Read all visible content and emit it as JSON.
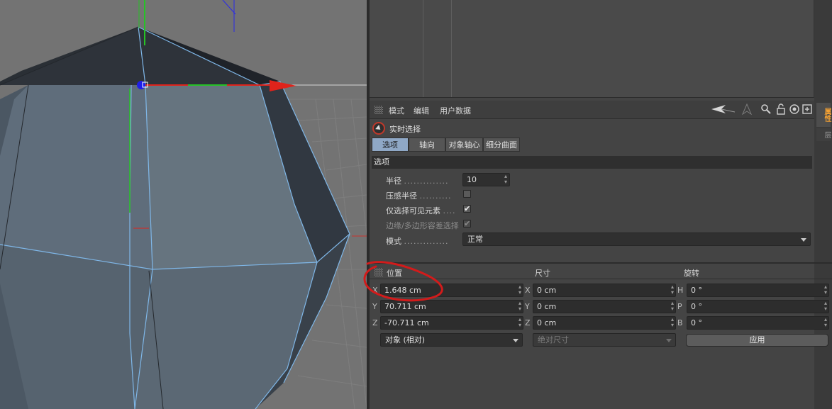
{
  "attributes": {
    "menu": [
      "模式",
      "编辑",
      "用户数据"
    ],
    "side_tabs": {
      "attributes": "属性",
      "layers": "层"
    },
    "tool_name": "实时选择",
    "tabs": [
      "选项",
      "轴向",
      "对象轴心",
      "细分曲面"
    ],
    "active_tab": "选项",
    "section": "选项",
    "radius_label": "半径",
    "radius_value": "10",
    "pressure_label": "压感半径",
    "visible_only_label": "仅选择可见元素",
    "edge_poly_label": "边缘/多边形容差选择",
    "mode_label": "模式",
    "mode_value": "正常",
    "check_mark": "✔",
    "dots_radius": "..............",
    "dots_pressure": "..........",
    "dots_visible": "....",
    "dots_mode": ".............."
  },
  "coordinates": {
    "columns": {
      "position": "位置",
      "size": "尺寸",
      "rotation": "旋转"
    },
    "position": {
      "x_label": "X",
      "y_label": "Y",
      "z_label": "Z",
      "x": "1.648 cm",
      "y": "70.711 cm",
      "z": "-70.711 cm"
    },
    "size": {
      "x_label": "X",
      "y_label": "Y",
      "z_label": "Z",
      "x": "0 cm",
      "y": "0 cm",
      "z": "0 cm"
    },
    "rotation": {
      "h_label": "H",
      "p_label": "P",
      "b_label": "B",
      "h": "0 °",
      "p": "0 °",
      "b": "0 °"
    },
    "coord_mode": "对象 (相对)",
    "size_mode": "绝对尺寸",
    "apply_label": "应用"
  },
  "colors": {
    "accent_orange": "#f2a033",
    "active_tab": "#8fa8c6",
    "axis_x": "#e0231b",
    "axis_y": "#26c226",
    "axis_z": "#2a2ae8",
    "annotation_red": "#d21b1b"
  },
  "icons": [
    "grip-icon",
    "arrow-tool-icon",
    "up-arrow-icon",
    "search-icon",
    "lock-icon",
    "target-icon",
    "new-panel-icon",
    "live-selection-icon",
    "spin-arrows-icon",
    "chevron-down-icon"
  ]
}
